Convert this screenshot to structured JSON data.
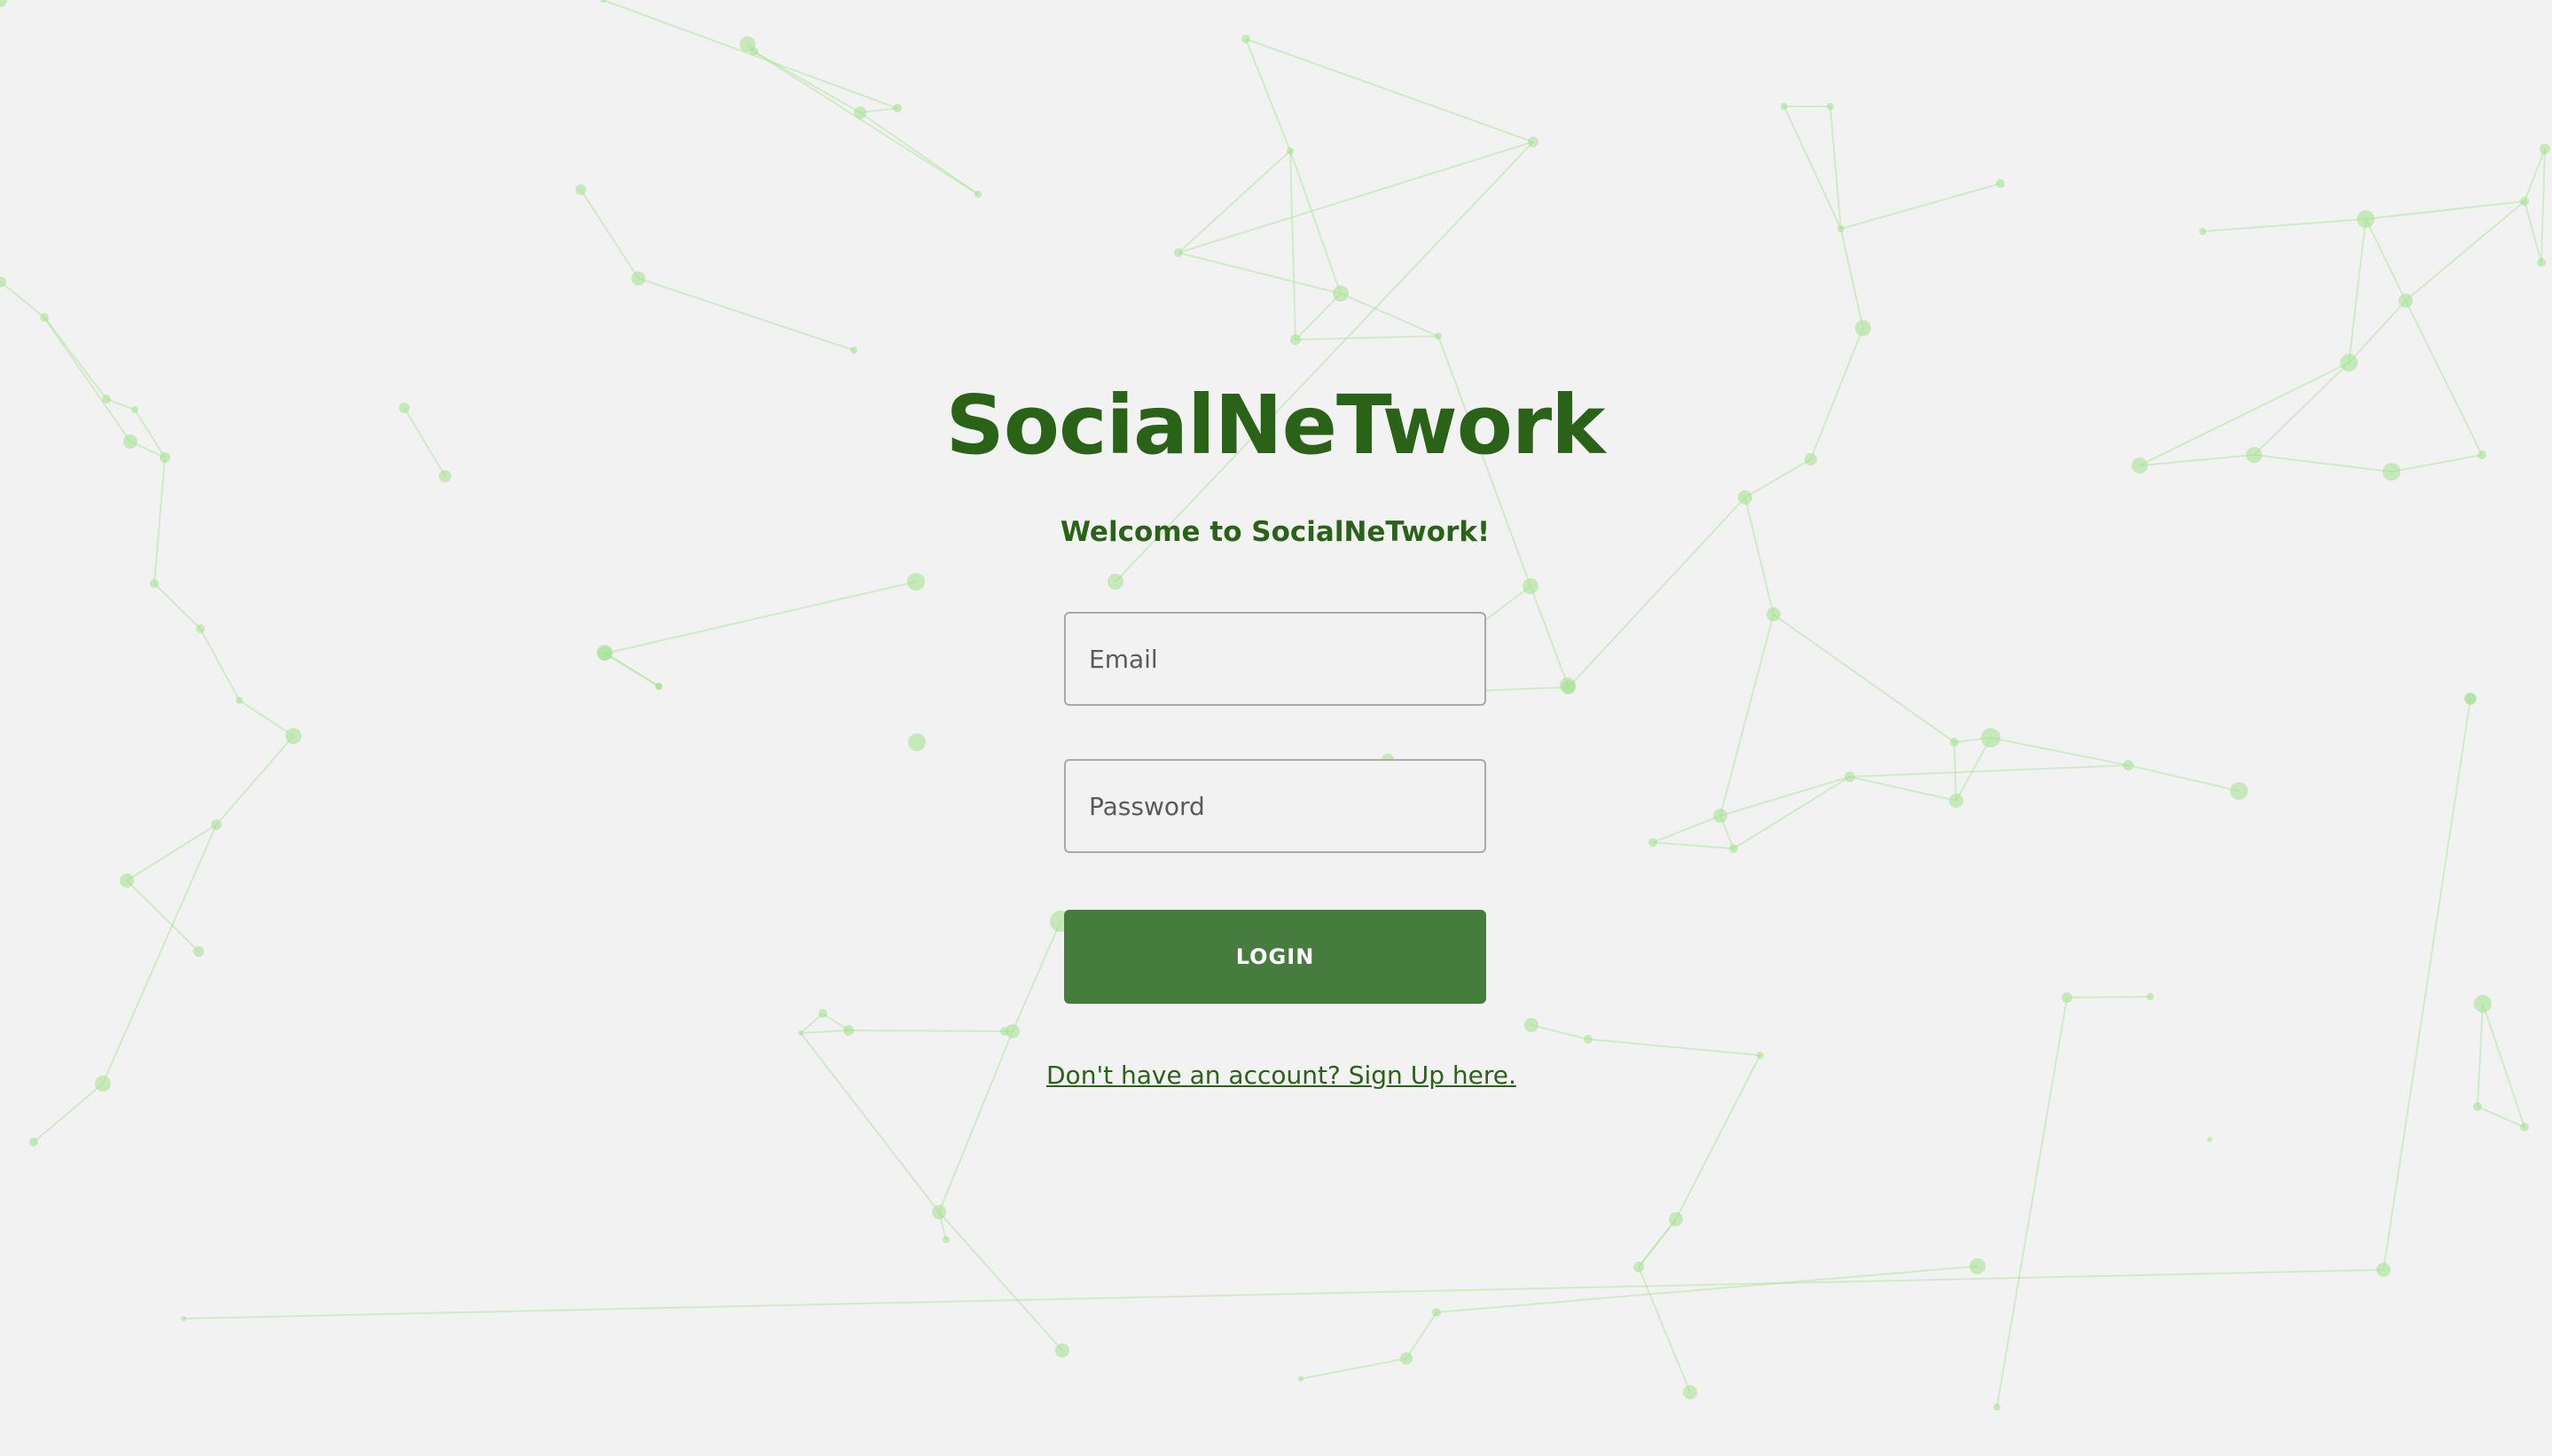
{
  "app": {
    "title": "SocialNeTwork",
    "welcome": "Welcome to SocialNeTwork!"
  },
  "form": {
    "email_placeholder": "Email",
    "email_value": "",
    "password_placeholder": "Password",
    "password_value": "",
    "login_label": "LOGIN",
    "signup_link": "Don't have an account? Sign Up here."
  },
  "colors": {
    "background": "#f2f2f2",
    "brand_green": "#2a6318",
    "button_green": "#467d3f",
    "network_green": "#9fe08a"
  }
}
